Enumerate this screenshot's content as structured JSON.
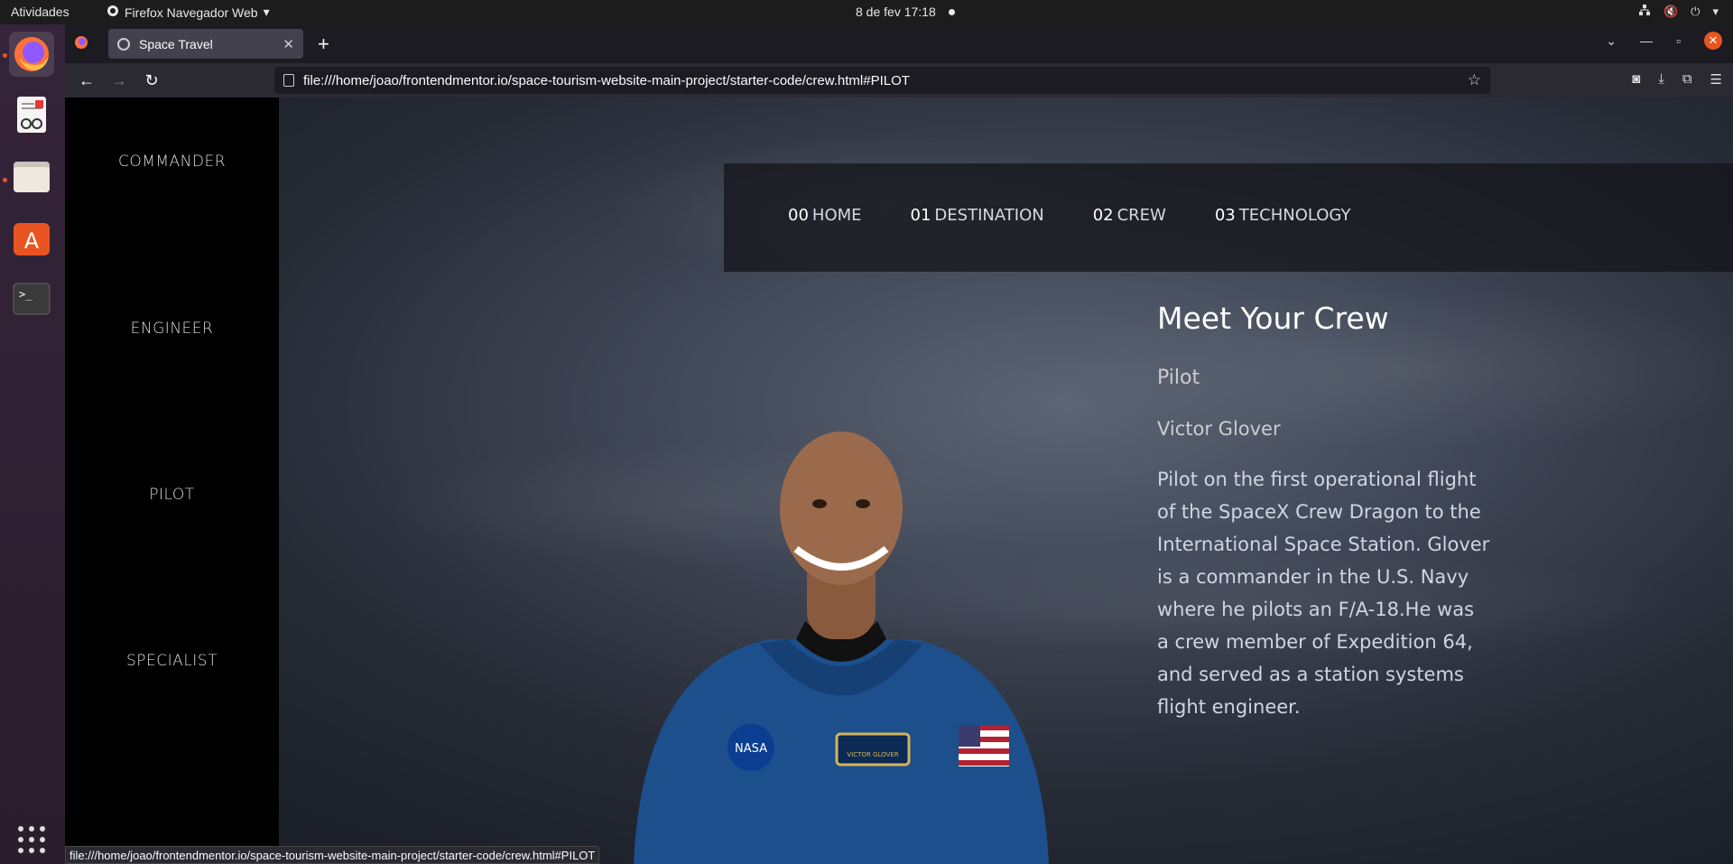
{
  "system": {
    "activities": "Atividades",
    "app_name": "Firefox Navegador Web",
    "datetime": "8 de fev  17:18"
  },
  "browser": {
    "tab_title": "Space Travel",
    "url": "file:///home/joao/frontendmentor.io/space-tourism-website-main-project/starter-code/crew.html#PILOT",
    "status_url": "file:///home/joao/frontendmentor.io/space-tourism-website-main-project/starter-code/crew.html#PILOT"
  },
  "sidenav": {
    "items": [
      "COMMANDER",
      "ENGINEER",
      "PILOT",
      "SPECIALIST"
    ]
  },
  "mainnav": {
    "items": [
      {
        "num": "00",
        "label": "HOME"
      },
      {
        "num": "01",
        "label": "DESTINATION"
      },
      {
        "num": "02",
        "label": "CREW"
      },
      {
        "num": "03",
        "label": "TECHNOLOGY"
      }
    ]
  },
  "crew": {
    "heading": "Meet Your Crew",
    "role": "Pilot",
    "name": "Victor Glover",
    "bio": "Pilot on the first operational flight of the SpaceX Crew Dragon to the International Space Station. Glover is a commander in the U.S. Navy where he pilots an F/A-18.He was a crew member of Expedition 64, and served as a station systems flight engineer.",
    "badge_text": "NASA",
    "name_patch": "VICTOR GLOVER"
  }
}
